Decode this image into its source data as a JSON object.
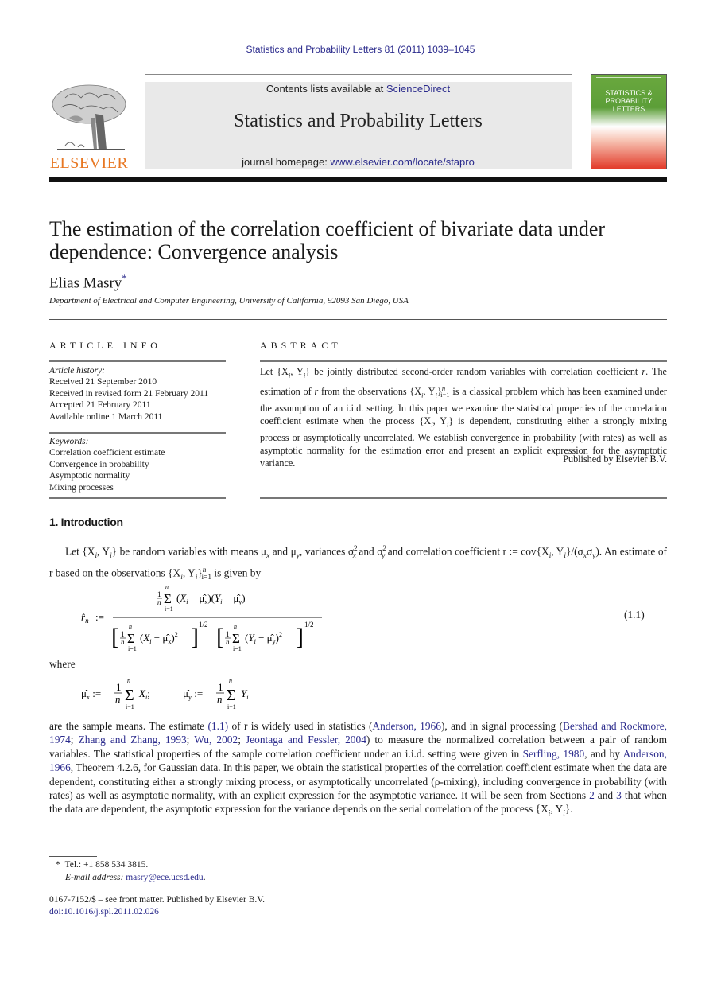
{
  "header": {
    "citation": "Statistics and Probability Letters 81 (2011) 1039–1045",
    "contents_prefix": "Contents lists available at ",
    "contents_link": "ScienceDirect",
    "journal_name": "Statistics and Probability Letters",
    "homepage_prefix": "journal homepage: ",
    "homepage_link": "www.elsevier.com/locate/stapro",
    "publisher_logo_text": "ELSEVIER",
    "cover_title_line1": "STATISTICS &",
    "cover_title_line2": "PROBABILITY",
    "cover_title_line3": "LETTERS",
    "colors": {
      "logo_orange": "#e87722",
      "link_blue": "#2a2a8c",
      "cover_green": "#5c9e38",
      "cover_red": "#e23b2a"
    }
  },
  "article": {
    "title_line1": "The estimation of the correlation coefficient of bivariate data under",
    "title_line2": "dependence: Convergence analysis",
    "author": "Elias Masry",
    "author_mark": "*",
    "affiliation": "Department of Electrical and Computer Engineering, University of California, 92093 San Diego, USA"
  },
  "article_info": {
    "heading": "ARTICLE INFO",
    "history_label": "Article history:",
    "history": [
      "Received 21 September 2010",
      "Received in revised form 21 February 2011",
      "Accepted 21 February 2011",
      "Available online 1 March 2011"
    ],
    "keywords_label": "Keywords:",
    "keywords": [
      "Correlation coefficient estimate",
      "Convergence in probability",
      "Asymptotic normality",
      "Mixing processes"
    ]
  },
  "abstract": {
    "heading": "ABSTRACT",
    "s1": "Let {X",
    "s2": ", Y",
    "s3": "} be jointly distributed second-order random variables with correlation coefficient ",
    "s4": ". The estimation of ",
    "s5": " from the observations {X",
    "s6": "} is a classical problem which has been examined under the assumption of an i.i.d. setting. In this paper we examine the statistical properties of the correlation coefficient estimate when the process {X",
    "s7": "} is dependent, constituting either a strongly mixing process or asymptotically uncorrelated. We establish convergence in probability (with rates) as well as asymptotic normality for the estimation error and present an explicit expression for the asymptotic variance.",
    "published": "Published by Elsevier B.V."
  },
  "intro": {
    "heading": "1.  Introduction",
    "p1_a": "Let {X",
    "p1_b": "} be random variables with means μ",
    "p1_c": " and μ",
    "p1_d": ", variances σ",
    "p1_e": " and σ",
    "p1_f": " and correlation coefficient r := cov{X",
    "p1_g": "}/(σ",
    "p1_h": "). An estimate of r based on the observations {X",
    "p1_i": " is given by",
    "equation_label": "(1.1)",
    "where": "where",
    "p2_a": "are the sample means. The estimate ",
    "p2_ref_eq": "(1.1)",
    "p2_b": " of r is widely used in statistics (",
    "p2_ref1": "Anderson, 1966",
    "p2_c": "), and in signal processing (",
    "p2_ref2": "Bershad and Rockmore, 1974",
    "p2_ref3": "Zhang and Zhang, 1993",
    "p2_ref4": "Wu, 2002",
    "p2_ref5": "Jeontaga and Fessler, 2004",
    "p2_d": ") to measure the normalized correlation between a pair of random variables. The statistical properties of the sample correlation coefficient under an i.i.d. setting were given in ",
    "p2_ref6": "Serfling, 1980",
    "p2_e": ", and by ",
    "p2_ref7": "Anderson, 1966",
    "p2_f": ", Theorem 4.2.6, for Gaussian data. In this paper, we obtain the statistical properties of the correlation coefficient estimate when the data are dependent, constituting either a strongly mixing process, or asymptotically uncorrelated (ρ-mixing), including convergence in probability (with rates) as well as asymptotic normality, with an explicit expression for the asymptotic variance. It will be seen from Sections ",
    "p2_ref8": "2",
    "p2_g": " and ",
    "p2_ref9": "3",
    "p2_h": " that when the data are dependent, the asymptotic expression for the variance depends on the serial correlation of the process {X"
  },
  "footnotes": {
    "mark": "*",
    "tel": "Tel.: +1 858 534 3815.",
    "email_label": "E-mail address: ",
    "email": "masry@ece.ucsd.edu",
    "issn": "0167-7152/$ – see front matter.  Published by Elsevier B.V.",
    "doi": "doi:10.1016/j.spl.2011.02.026"
  }
}
